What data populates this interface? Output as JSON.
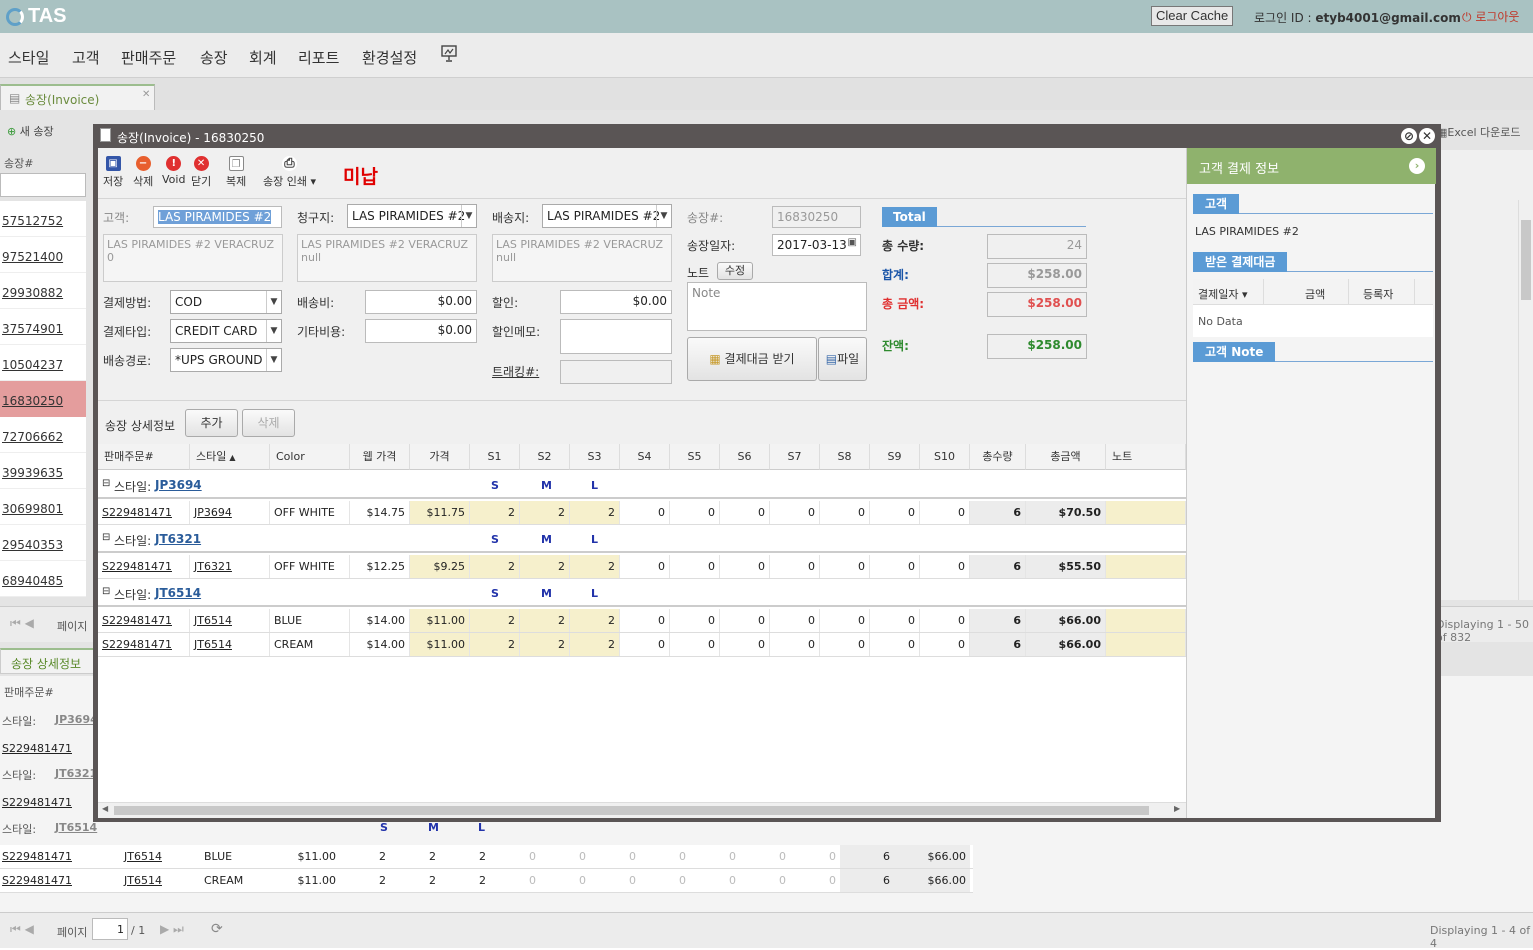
{
  "app": {
    "logo": "TAS",
    "clear_cache": "Clear Cache",
    "login_label": "로그인 ID : ",
    "login_id": "etyb4001@gmail.com",
    "logout": "로그아웃"
  },
  "menu": [
    "스타일",
    "고객",
    "판매주문",
    "송장",
    "회계",
    "리포트",
    "환경설정"
  ],
  "bg": {
    "tab_label": "송장(Invoice)",
    "new_invoice": "새 송장",
    "excel_download": "Excel 다운로드",
    "list_header": "송장#",
    "invoice_list": [
      "57512752",
      "97521400",
      "29930882",
      "37574901",
      "10504237",
      "16830250",
      "72706662",
      "39939635",
      "30699801",
      "29540353",
      "68940485"
    ],
    "page_label": "페이지",
    "displaying_top": "Displaying 1 - 50 of 832",
    "detail_tab": "송장 상세정보",
    "detail_col": "판매주문#",
    "style_prefix": "스타일:",
    "groups": [
      {
        "style": "JP3694",
        "rows": []
      },
      {
        "style": "JT6321",
        "rows": []
      },
      {
        "style": "JT6514",
        "sizes": [
          "S",
          "M",
          "L"
        ],
        "rows": [
          {
            "order": "S229481471",
            "style": "JT6514",
            "color": "BLUE",
            "price": "$11.00",
            "s": [
              "2",
              "2",
              "2",
              "0",
              "0",
              "0",
              "0",
              "0",
              "0",
              "0"
            ],
            "qty": "6",
            "amt": "$66.00"
          },
          {
            "order": "S229481471",
            "style": "JT6514",
            "color": "CREAM",
            "price": "$11.00",
            "s": [
              "2",
              "2",
              "2",
              "0",
              "0",
              "0",
              "0",
              "0",
              "0",
              "0"
            ],
            "qty": "6",
            "amt": "$66.00"
          }
        ]
      }
    ],
    "order_ref": "S229481471",
    "pager_page": "1",
    "pager_total": "/ 1",
    "displaying_bottom": "Displaying 1 - 4 of 4"
  },
  "modal": {
    "title": "송장(Invoice) - 16830250",
    "toolbar": {
      "save": "저장",
      "delete": "삭제",
      "void": "Void",
      "close": "닫기",
      "copy": "복제",
      "print": "송장 인쇄"
    },
    "status": "미납",
    "customer_label": "고객:",
    "customer": "LAS PIRAMIDES #2",
    "customer_addr": "LAS PIRAMIDES #2 VERACRUZ 0",
    "billto_label": "청구지:",
    "billto": "LAS PIRAMIDES #2",
    "billto_addr1": "LAS PIRAMIDES #2  VERACRUZ",
    "billto_addr2": "null",
    "shipto_label": "배송지:",
    "shipto": "LAS PIRAMIDES #2",
    "shipto_addr1": "LAS PIRAMIDES #2  VERACRUZ",
    "shipto_addr2": "null",
    "invoice_no_label": "송장#:",
    "invoice_no": "16830250",
    "invoice_date_label": "송장일자:",
    "invoice_date": "2017-03-13",
    "note_label": "노트",
    "note_edit": "수정",
    "note_placeholder": "Note",
    "payment_method_label": "결제방법:",
    "payment_method": "COD",
    "payment_type_label": "결제타입:",
    "payment_type": "CREDIT CARD",
    "ship_route_label": "배송경로:",
    "ship_route": "*UPS GROUND",
    "shipping_fee_label": "배송비:",
    "shipping_fee": "$0.00",
    "other_fee_label": "기타비용:",
    "other_fee": "$0.00",
    "discount_label": "할인:",
    "discount": "$0.00",
    "discount_memo_label": "할인메모:",
    "tracking_label": "트래킹#:",
    "receive_payment": "결제대금 받기",
    "file_button": "파일",
    "total_tab": "Total",
    "total_qty_label": "총 수량:",
    "total_qty": "24",
    "subtotal_label": "합계:",
    "subtotal": "$258.00",
    "grand_total_label": "총 금액:",
    "grand_total": "$258.00",
    "balance_label": "잔액:",
    "balance": "$258.00",
    "detail_label": "송장 상세정보",
    "add_btn": "추가",
    "delete_btn": "삭제",
    "columns": [
      "판매주문#",
      "스타일",
      "Color",
      "웹 가격",
      "가격",
      "S1",
      "S2",
      "S3",
      "S4",
      "S5",
      "S6",
      "S7",
      "S8",
      "S9",
      "S10",
      "총수량",
      "총금액",
      "노트"
    ],
    "style_prefix": "스타일:",
    "groups": [
      {
        "style": "JP3694",
        "sizes": [
          "S",
          "M",
          "L"
        ],
        "rows": [
          {
            "order": "S229481471",
            "style": "JP3694",
            "color": "OFF WHITE",
            "web": "$14.75",
            "price": "$11.75",
            "s": [
              "2",
              "2",
              "2",
              "0",
              "0",
              "0",
              "0",
              "0",
              "0",
              "0"
            ],
            "qty": "6",
            "amt": "$70.50"
          }
        ]
      },
      {
        "style": "JT6321",
        "sizes": [
          "S",
          "M",
          "L"
        ],
        "rows": [
          {
            "order": "S229481471",
            "style": "JT6321",
            "color": "OFF WHITE",
            "web": "$12.25",
            "price": "$9.25",
            "s": [
              "2",
              "2",
              "2",
              "0",
              "0",
              "0",
              "0",
              "0",
              "0",
              "0"
            ],
            "qty": "6",
            "amt": "$55.50"
          }
        ]
      },
      {
        "style": "JT6514",
        "sizes": [
          "S",
          "M",
          "L"
        ],
        "rows": [
          {
            "order": "S229481471",
            "style": "JT6514",
            "color": "BLUE",
            "web": "$14.00",
            "price": "$11.00",
            "s": [
              "2",
              "2",
              "2",
              "0",
              "0",
              "0",
              "0",
              "0",
              "0",
              "0"
            ],
            "qty": "6",
            "amt": "$66.00"
          },
          {
            "order": "S229481471",
            "style": "JT6514",
            "color": "CREAM",
            "web": "$14.00",
            "price": "$11.00",
            "s": [
              "2",
              "2",
              "2",
              "0",
              "0",
              "0",
              "0",
              "0",
              "0",
              "0"
            ],
            "qty": "6",
            "amt": "$66.00"
          }
        ]
      }
    ]
  },
  "payment_panel": {
    "title": "고객 결제 정보",
    "customer_tab": "고객",
    "customer_name": "LAS PIRAMIDES #2",
    "received_tab": "받은 결제대금",
    "columns": [
      "결제일자",
      "금액",
      "등록자"
    ],
    "empty": "No Data",
    "note_tab": "고객 Note"
  }
}
